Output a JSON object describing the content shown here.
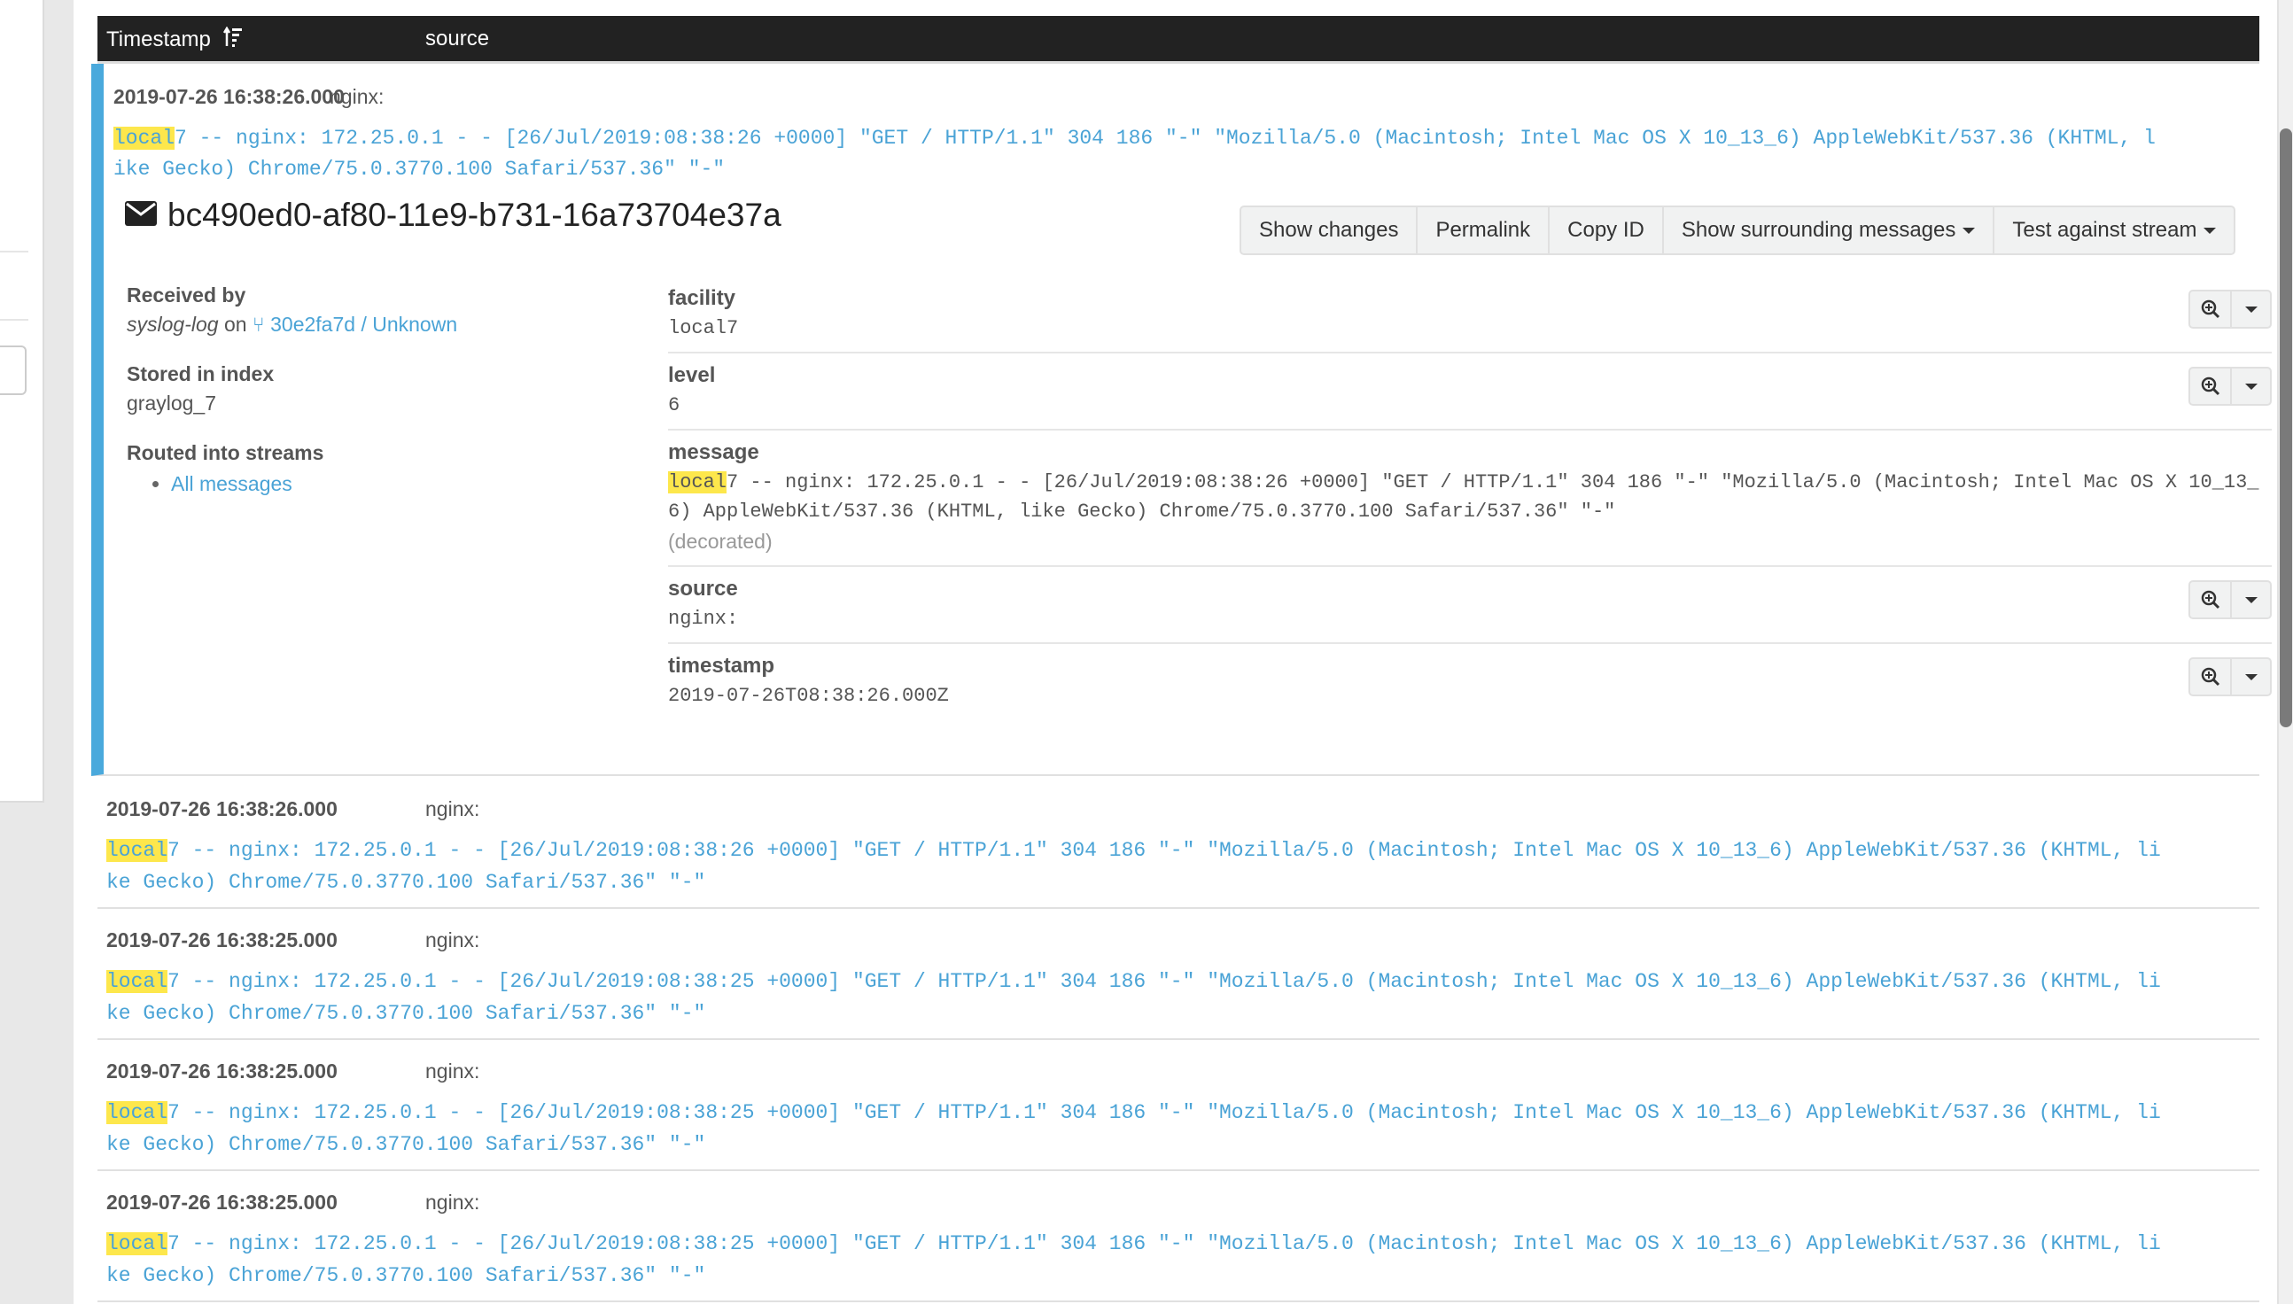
{
  "table": {
    "columns": [
      {
        "label": "Timestamp",
        "sort_icon": "sort-amount-asc-icon"
      },
      {
        "label": "source"
      }
    ]
  },
  "selected_message": {
    "timestamp": "2019-07-26 16:38:26.000",
    "source": "nginx:",
    "message_highlight": "local",
    "message_line1_rest": "7 -- nginx: 172.25.0.1 - - [26/Jul/2019:08:38:26 +0000] \"GET / HTTP/1.1\" 304 186 \"-\" \"Mozilla/5.0 (Macintosh; Intel Mac OS X 10_13_6) AppleWebKit/537.36 (KHTML, l",
    "message_line2": "ike Gecko) Chrome/75.0.3770.100 Safari/537.36\" \"-\"",
    "id": "bc490ed0-af80-11e9-b731-16a73704e37a",
    "id_icon": "envelope-icon",
    "actions": [
      {
        "label": "Show changes",
        "dropdown": false
      },
      {
        "label": "Permalink",
        "dropdown": false
      },
      {
        "label": "Copy ID",
        "dropdown": false
      },
      {
        "label": "Show surrounding messages",
        "dropdown": true
      },
      {
        "label": "Test against stream",
        "dropdown": true
      }
    ],
    "meta": {
      "received_by_label": "Received by",
      "input_name": "syslog-log",
      "on_text": "on",
      "node_icon": "code-fork-icon",
      "node_link": "30e2fa7d / Unknown",
      "stored_label": "Stored in index",
      "index": "graylog_7",
      "routed_label": "Routed into streams",
      "streams": [
        "All messages"
      ]
    },
    "fields": [
      {
        "name": "facility",
        "value": "local7",
        "actions": true
      },
      {
        "name": "level",
        "value": "6",
        "actions": true
      },
      {
        "name": "message",
        "value_highlight": "local",
        "value_rest": "7 -- nginx: 172.25.0.1 - - [26/Jul/2019:08:38:26 +0000] \"GET / HTTP/1.1\" 304 186 \"-\" \"Mozilla/5.0 (Macintosh; Intel Mac OS X 10_13_6) AppleWebKit/537.36 (KHTML, like Gecko) Chrome/75.0.3770.100 Safari/537.36\" \"-\"",
        "note": "(decorated)",
        "actions": false
      },
      {
        "name": "source",
        "value": "nginx:",
        "actions": true
      },
      {
        "name": "timestamp",
        "value": "2019-07-26T08:38:26.000Z",
        "actions": true
      }
    ],
    "field_action_icons": [
      "search-plus-icon",
      "caret-down-icon"
    ]
  },
  "rows": [
    {
      "timestamp": "2019-07-26 16:38:26.000",
      "source": "nginx:",
      "highlight": "local",
      "line1_rest": "7 -- nginx: 172.25.0.1 - - [26/Jul/2019:08:38:26 +0000] \"GET / HTTP/1.1\" 304 186 \"-\" \"Mozilla/5.0 (Macintosh; Intel Mac OS X 10_13_6) AppleWebKit/537.36 (KHTML, li",
      "line2": "ke Gecko) Chrome/75.0.3770.100 Safari/537.36\" \"-\""
    },
    {
      "timestamp": "2019-07-26 16:38:25.000",
      "source": "nginx:",
      "highlight": "local",
      "line1_rest": "7 -- nginx: 172.25.0.1 - - [26/Jul/2019:08:38:25 +0000] \"GET / HTTP/1.1\" 304 186 \"-\" \"Mozilla/5.0 (Macintosh; Intel Mac OS X 10_13_6) AppleWebKit/537.36 (KHTML, li",
      "line2": "ke Gecko) Chrome/75.0.3770.100 Safari/537.36\" \"-\""
    },
    {
      "timestamp": "2019-07-26 16:38:25.000",
      "source": "nginx:",
      "highlight": "local",
      "line1_rest": "7 -- nginx: 172.25.0.1 - - [26/Jul/2019:08:38:25 +0000] \"GET / HTTP/1.1\" 304 186 \"-\" \"Mozilla/5.0 (Macintosh; Intel Mac OS X 10_13_6) AppleWebKit/537.36 (KHTML, li",
      "line2": "ke Gecko) Chrome/75.0.3770.100 Safari/537.36\" \"-\""
    },
    {
      "timestamp": "2019-07-26 16:38:25.000",
      "source": "nginx:",
      "highlight": "local",
      "line1_rest": "7 -- nginx: 172.25.0.1 - - [26/Jul/2019:08:38:25 +0000] \"GET / HTTP/1.1\" 304 186 \"-\" \"Mozilla/5.0 (Macintosh; Intel Mac OS X 10_13_6) AppleWebKit/537.36 (KHTML, li",
      "line2": "ke Gecko) Chrome/75.0.3770.100 Safari/537.36\" \"-\""
    }
  ],
  "colors": {
    "accent": "#4aa9dc",
    "link": "#4aa3d6",
    "highlight": "#fde74c",
    "header_bg": "#222222"
  }
}
